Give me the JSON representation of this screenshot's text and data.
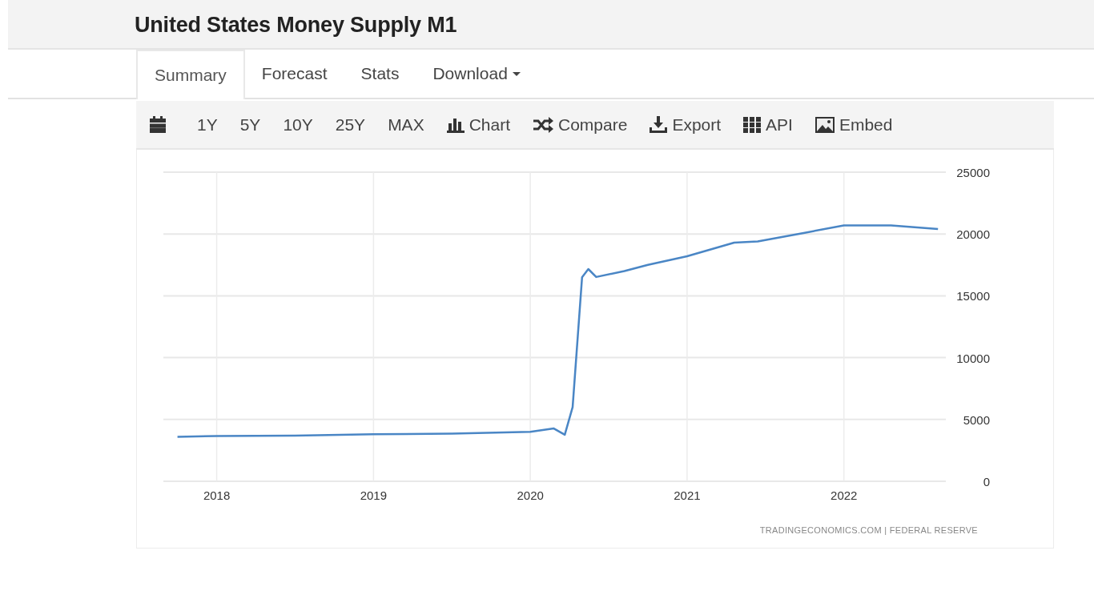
{
  "header": {
    "title": "United States Money Supply M1"
  },
  "tabs": [
    {
      "label": "Summary",
      "selected": true,
      "dropdown": false
    },
    {
      "label": "Forecast",
      "selected": false,
      "dropdown": false
    },
    {
      "label": "Stats",
      "selected": false,
      "dropdown": false
    },
    {
      "label": "Download",
      "selected": false,
      "dropdown": true
    }
  ],
  "toolbar": [
    {
      "kind": "calendar"
    },
    {
      "kind": "range",
      "label": "1Y"
    },
    {
      "kind": "range",
      "label": "5Y"
    },
    {
      "kind": "range",
      "label": "10Y"
    },
    {
      "kind": "range",
      "label": "25Y"
    },
    {
      "kind": "range",
      "label": "MAX"
    },
    {
      "kind": "chart",
      "label": "Chart"
    },
    {
      "kind": "compare",
      "label": "Compare"
    },
    {
      "kind": "export",
      "label": "Export"
    },
    {
      "kind": "api",
      "label": "API"
    },
    {
      "kind": "embed",
      "label": "Embed"
    }
  ],
  "chart": {
    "source": "TRADINGECONOMICS.COM  |  FEDERAL RESERVE",
    "chart_data": {
      "type": "line",
      "x": [
        2017.75,
        2018,
        2018.5,
        2019,
        2019.5,
        2020,
        2020.15,
        2020.22,
        2020.27,
        2020.33,
        2020.37,
        2020.42,
        2020.6,
        2020.75,
        2021,
        2021.3,
        2021.45,
        2021.75,
        2022,
        2022.3,
        2022.6
      ],
      "series": [
        {
          "color": "#4a86c5",
          "values": [
            3600,
            3650,
            3700,
            3800,
            3850,
            4000,
            4270,
            3760,
            6000,
            16500,
            17160,
            16520,
            17000,
            17500,
            18200,
            19300,
            19400,
            20100,
            20700,
            20700,
            20400
          ]
        }
      ],
      "xticks": [
        2018,
        2019,
        2020,
        2021,
        2022
      ],
      "yticks": [
        0,
        5000,
        10000,
        15000,
        20000,
        25000
      ],
      "xlim": [
        2017.66,
        2022.65
      ],
      "ylim": [
        0,
        25000
      ],
      "grid": true
    }
  }
}
